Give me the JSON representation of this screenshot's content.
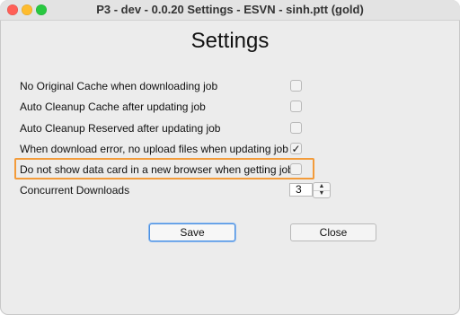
{
  "window": {
    "title": "P3 - dev - 0.0.20 Settings  - ESVN - sinh.ptt (gold)"
  },
  "page": {
    "heading": "Settings"
  },
  "settings": [
    {
      "label": "No Original Cache when downloading job",
      "checked": false
    },
    {
      "label": "Auto Cleanup Cache after updating job",
      "checked": false
    },
    {
      "label": "Auto Cleanup Reserved after updating job",
      "checked": false
    },
    {
      "label": "When download error, no upload files when updating job",
      "checked": true
    },
    {
      "label": "Do not show data card in a new browser when getting job",
      "checked": false
    }
  ],
  "check_mark": "✓",
  "concurrent": {
    "label": "Concurrent Downloads",
    "value": "3"
  },
  "spinner": {
    "up": "▲",
    "down": "▼"
  },
  "buttons": {
    "save": "Save",
    "close": "Close"
  },
  "colors": {
    "highlight": "#f39b3a",
    "focus": "#4a90e2"
  }
}
